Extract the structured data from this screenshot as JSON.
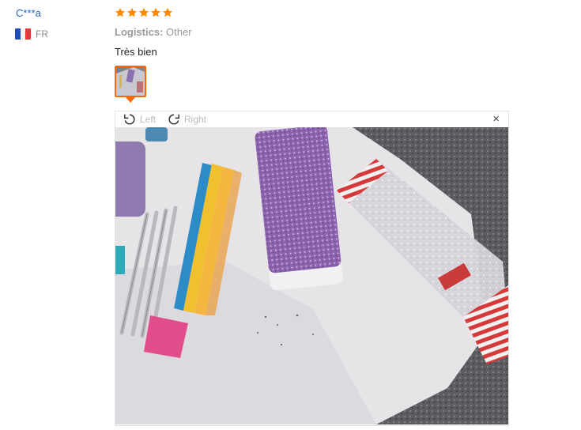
{
  "reviewer": {
    "name": "C***a",
    "country_code": "FR"
  },
  "review": {
    "rating": 5,
    "logistics_label": "Logistics:",
    "logistics_value": "Other",
    "comment": "Très bien"
  },
  "viewer": {
    "rotate_left_label": "Left",
    "rotate_right_label": "Right",
    "close_label": "×"
  },
  "colors": {
    "star": "#ff8a00",
    "thumb_border": "#ff6a00",
    "username": "#2462b8"
  },
  "icons": [
    "star-icon",
    "rotate-left-icon",
    "rotate-right-icon",
    "close-icon",
    "france-flag-icon"
  ]
}
